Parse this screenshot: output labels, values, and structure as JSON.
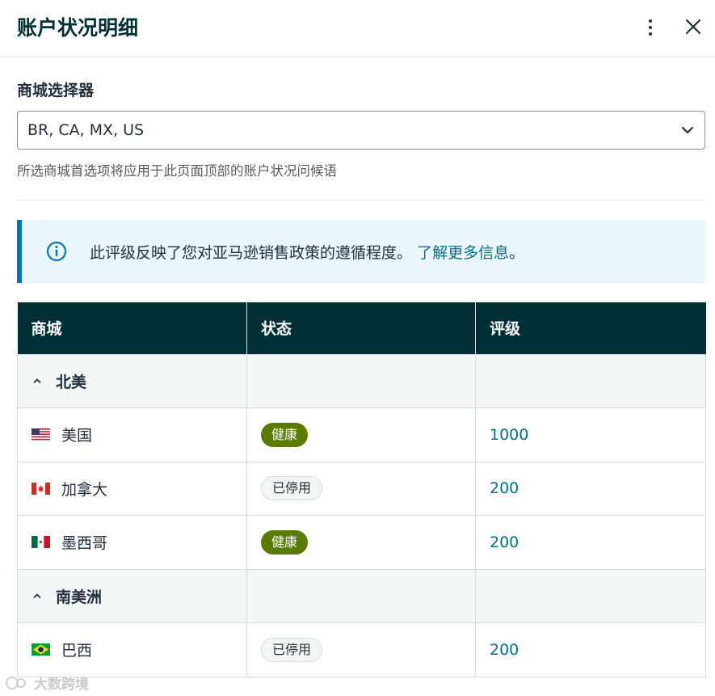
{
  "header": {
    "title": "账户状况明细"
  },
  "selector": {
    "label": "商城选择器",
    "value": "BR, CA, MX, US",
    "hint": "所选商城首选项将应用于此页面顶部的账户状况问候语"
  },
  "info": {
    "text": "此评级反映了您对亚马逊销售政策的遵循程度。",
    "link": "了解更多信息",
    "suffix": "。"
  },
  "table": {
    "headers": [
      "商城",
      "状态",
      "评级"
    ],
    "groups": [
      {
        "name": "北美",
        "rows": [
          {
            "country": "美国",
            "flag": "us-flag-icon",
            "status": "健康",
            "status_type": "healthy",
            "rating": "1000"
          },
          {
            "country": "加拿大",
            "flag": "ca-flag-icon",
            "status": "已停用",
            "status_type": "disabled",
            "rating": "200"
          },
          {
            "country": "墨西哥",
            "flag": "mx-flag-icon",
            "status": "健康",
            "status_type": "healthy",
            "rating": "200"
          }
        ]
      },
      {
        "name": "南美洲",
        "rows": [
          {
            "country": "巴西",
            "flag": "br-flag-icon",
            "status": "已停用",
            "status_type": "disabled",
            "rating": "200"
          }
        ]
      }
    ]
  },
  "watermark": {
    "text": "大数跨境"
  },
  "colors": {
    "header_bg": "#002f36",
    "healthy": "#5a7a00",
    "link": "#007185",
    "info_accent": "#0073bb"
  }
}
